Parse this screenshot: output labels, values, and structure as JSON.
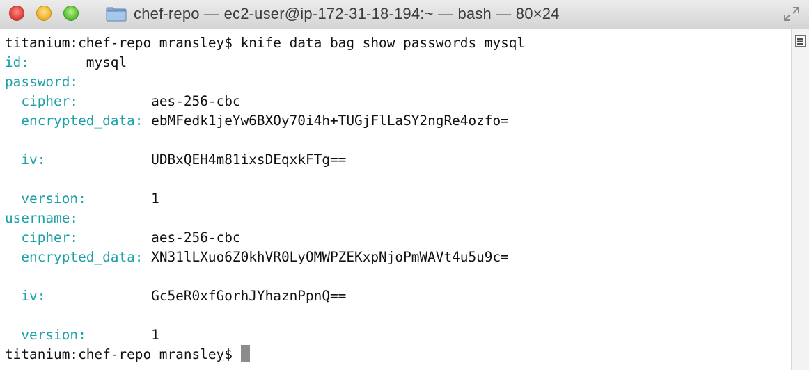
{
  "window": {
    "title": "chef-repo — ec2-user@ip-172-31-18-194:~ — bash — 80×24"
  },
  "terminal": {
    "lines": [
      {
        "kind": "prompt",
        "prompt": "titanium:chef-repo mransley$ ",
        "text": "knife data bag show passwords mysql"
      },
      {
        "kind": "kv",
        "indent": "",
        "key": "id:",
        "pad": "       ",
        "value": "mysql"
      },
      {
        "kind": "kv",
        "indent": "",
        "key": "password:",
        "pad": "",
        "value": ""
      },
      {
        "kind": "kv",
        "indent": "  ",
        "key": "cipher:",
        "pad": "         ",
        "value": "aes-256-cbc"
      },
      {
        "kind": "kv",
        "indent": "  ",
        "key": "encrypted_data:",
        "pad": " ",
        "value": "ebMFedk1jeYw6BXOy70i4h+TUGjFlLaSY2ngRe4ozfo="
      },
      {
        "kind": "blank"
      },
      {
        "kind": "kv",
        "indent": "  ",
        "key": "iv:",
        "pad": "             ",
        "value": "UDBxQEH4m81ixsDEqxkFTg=="
      },
      {
        "kind": "blank"
      },
      {
        "kind": "kv",
        "indent": "  ",
        "key": "version:",
        "pad": "        ",
        "value": "1"
      },
      {
        "kind": "kv",
        "indent": "",
        "key": "username:",
        "pad": "",
        "value": ""
      },
      {
        "kind": "kv",
        "indent": "  ",
        "key": "cipher:",
        "pad": "         ",
        "value": "aes-256-cbc"
      },
      {
        "kind": "kv",
        "indent": "  ",
        "key": "encrypted_data:",
        "pad": " ",
        "value": "XN31lLXuo6Z0khVR0LyOMWPZEKxpNjoPmWAVt4u5u9c="
      },
      {
        "kind": "blank"
      },
      {
        "kind": "kv",
        "indent": "  ",
        "key": "iv:",
        "pad": "             ",
        "value": "Gc5eR0xfGorhJYhaznPpnQ=="
      },
      {
        "kind": "blank"
      },
      {
        "kind": "kv",
        "indent": "  ",
        "key": "version:",
        "pad": "        ",
        "value": "1"
      },
      {
        "kind": "prompt-cursor",
        "prompt": "titanium:chef-repo mransley$ ",
        "text": ""
      }
    ]
  },
  "colors": {
    "key": "#1ba1a8",
    "text": "#111111",
    "cursor": "#8c8c8c"
  },
  "icons": {
    "title_folder": "folder-icon",
    "fullscreen": "fullscreen-icon",
    "scroll": "scroll-handle-icon"
  }
}
